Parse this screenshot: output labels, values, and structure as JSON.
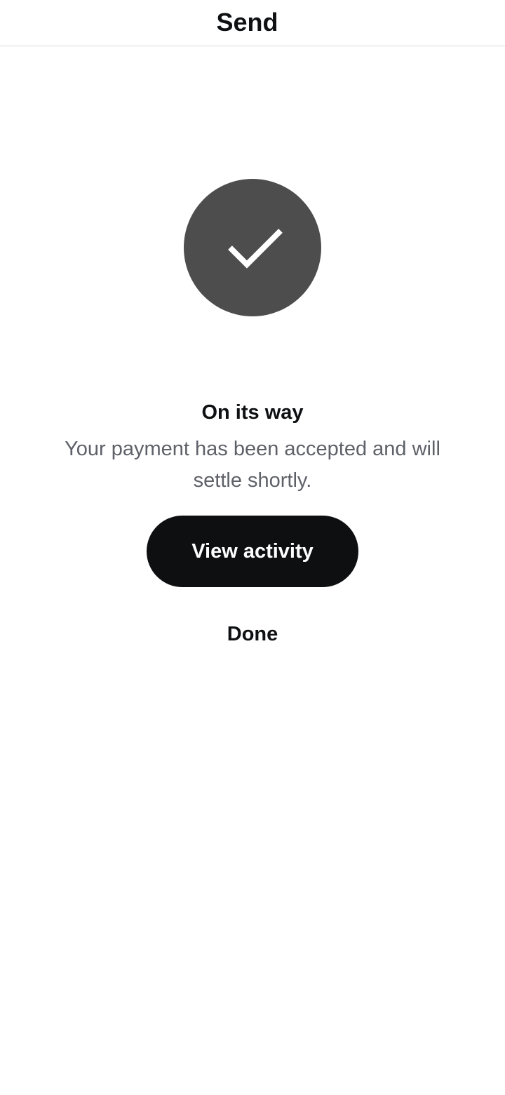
{
  "header": {
    "title": "Send"
  },
  "status": {
    "icon": "checkmark-icon",
    "title": "On its way",
    "message": "Your payment has been accepted and will settle shortly."
  },
  "actions": {
    "view_activity_label": "View activity",
    "done_label": "Done"
  },
  "colors": {
    "icon_circle": "#4d4d4d",
    "primary_button": "#0d0f11",
    "message_text": "#5f6169"
  }
}
